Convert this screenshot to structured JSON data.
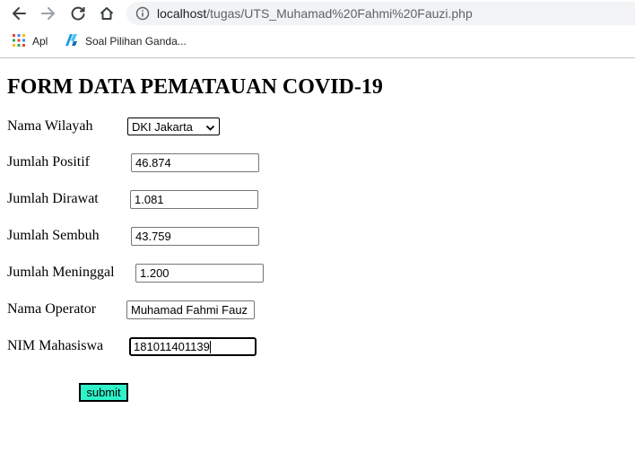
{
  "browser": {
    "url_host": "localhost",
    "url_path": "/tugas/UTS_Muhamad%20Fahmi%20Fauzi.php",
    "bookmarks": [
      {
        "label": "Apl",
        "icon": "apps-grid-icon"
      },
      {
        "label": "Soal Pilihan Ganda...",
        "icon": "bookmark-favicon-icon"
      }
    ]
  },
  "form": {
    "title": "FORM DATA PEMATAUAN COVID-19",
    "wilayah": {
      "label": "Nama Wilayah",
      "selected": "DKI Jakarta"
    },
    "positif": {
      "label": "Jumlah Positif",
      "value": "46.874"
    },
    "dirawat": {
      "label": "Jumlah Dirawat",
      "value": "1.081"
    },
    "sembuh": {
      "label": "Jumlah Sembuh",
      "value": "43.759"
    },
    "meninggal": {
      "label": "Jumlah Meninggal",
      "value": "1.200"
    },
    "operator": {
      "label": "Nama Operator",
      "value": "Muhamad Fahmi Fauz"
    },
    "nim": {
      "label": "NIM Mahasiswa",
      "value": "181011401139"
    },
    "submit_label": "submit",
    "submit_color": "#2ef2c9"
  }
}
